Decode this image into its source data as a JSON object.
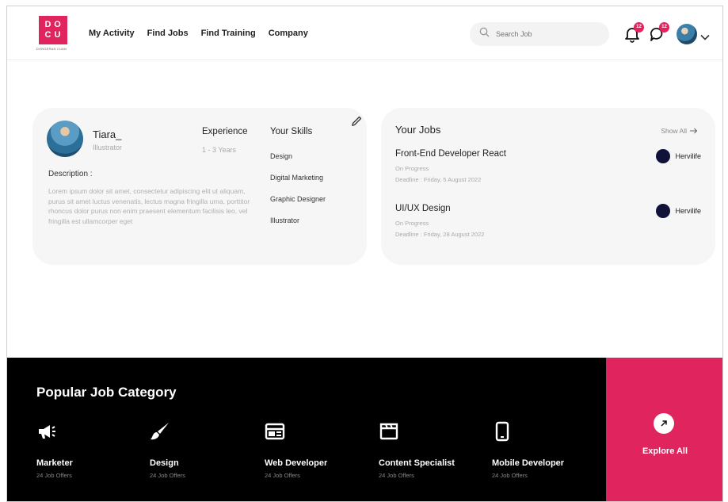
{
  "brand": {
    "logo_letters": [
      "D",
      "O",
      "C",
      "U"
    ],
    "logo_subtitle": "DONGERAN CUAN",
    "color": "#e0245e"
  },
  "nav": {
    "items": [
      "My Activity",
      "Find Jobs",
      "Find Training",
      "Company"
    ]
  },
  "search": {
    "placeholder": "Search Job"
  },
  "header": {
    "notification_count": "12",
    "message_count": "12"
  },
  "profile": {
    "name": "Tiara_",
    "role": "Illustrator",
    "description_label": "Description :",
    "description": "Lorem ipsum dolor sit amet, consectetur adipiscing elit ut aliquam, purus sit amet luctus venenatis, lectus magna fringilla urna, porttitor rhoncus dolor purus non enim praesent elementum facilisis leo, vel fringilla est ullamcorper eget",
    "experience_label": "Experience",
    "experience_value": "1 - 3 Years",
    "skills_label": "Your Skills",
    "skills": [
      "Design",
      "Digital Marketing",
      "Graphic Designer",
      "Illustrator"
    ]
  },
  "jobs": {
    "title": "Your Jobs",
    "show_all": "Show All",
    "items": [
      {
        "name": "Front-End Developer React",
        "status": "On Progress",
        "deadline": "Deadline : Friday, 5 August 2022",
        "company": "Hervilife"
      },
      {
        "name": "UI/UX Design",
        "status": "On Progress",
        "deadline": "Deadline : Friday, 28 August 2022",
        "company": "Hervilife"
      }
    ]
  },
  "categories": {
    "title": "Popular Job Category",
    "items": [
      {
        "name": "Marketer",
        "count": "24 Job Offers",
        "icon": "megaphone-icon"
      },
      {
        "name": "Design",
        "count": "24 Job Offers",
        "icon": "brush-icon"
      },
      {
        "name": "Web Developer",
        "count": "24 Job Offers",
        "icon": "browser-window-icon"
      },
      {
        "name": "Content Specialist",
        "count": "24 Job Offers",
        "icon": "clapperboard-icon"
      },
      {
        "name": "Mobile Developer",
        "count": "24 Job Offers",
        "icon": "smartphone-icon"
      }
    ],
    "explore_label": "Explore All"
  }
}
